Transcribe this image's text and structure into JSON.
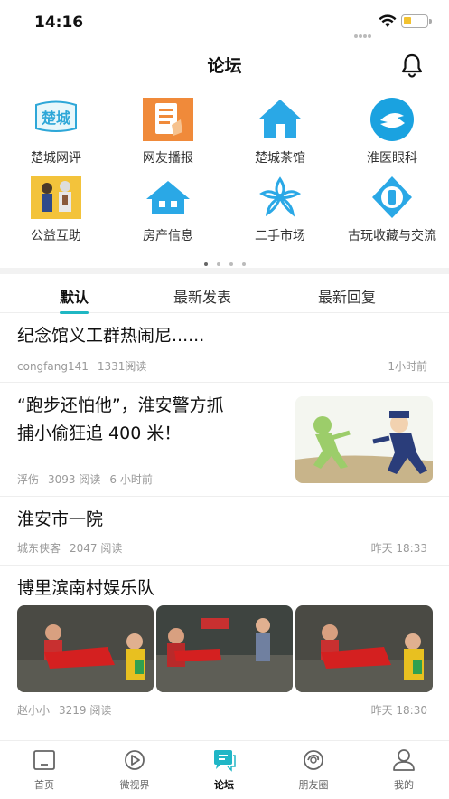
{
  "status": {
    "time": "14:16"
  },
  "header": {
    "title": "论坛"
  },
  "categories": [
    {
      "label": "楚城网评",
      "icon": "chucheng-logo-icon",
      "logo_text": "楚城"
    },
    {
      "label": "网友播报",
      "icon": "news-report-icon"
    },
    {
      "label": "楚城茶馆",
      "icon": "house-icon"
    },
    {
      "label": "淮医眼科",
      "icon": "eye-clinic-logo-icon"
    },
    {
      "label": "公益互助",
      "icon": "charity-photo-icon"
    },
    {
      "label": "房产信息",
      "icon": "house-store-icon"
    },
    {
      "label": "二手市场",
      "icon": "flower-logo-icon"
    },
    {
      "label": "古玩收藏与交流",
      "icon": "antique-coin-icon"
    }
  ],
  "tabs": [
    "默认",
    "最新发表",
    "最新回复"
  ],
  "posts": [
    {
      "title": "纪念馆义工群热闹尼......",
      "author": "congfang141",
      "reads": "1331阅读",
      "time": "1小时前"
    },
    {
      "title_line1": "“跑步还怕他”，淮安警方抓",
      "title_line2": "捕小偷狂追 400 米！",
      "author": "浮伤",
      "reads": "3093 阅读",
      "time": "6 小时前"
    },
    {
      "title": "淮安市一院",
      "author": "城东侠客",
      "reads": "2047 阅读",
      "time": "昨天 18:33"
    },
    {
      "title": "博里滨南村娱乐队",
      "author": "赵小小",
      "reads": "3219 阅读",
      "time": "昨天 18:30"
    }
  ],
  "tabbar": [
    {
      "label": "首页",
      "icon": "home-icon"
    },
    {
      "label": "微视界",
      "icon": "video-play-icon"
    },
    {
      "label": "论坛",
      "icon": "forum-chat-icon"
    },
    {
      "label": "朋友圈",
      "icon": "moments-icon"
    },
    {
      "label": "我的",
      "icon": "profile-icon"
    }
  ],
  "colors": {
    "accent": "#1fb7c3",
    "active_tab_icon": "#20b6c6"
  }
}
